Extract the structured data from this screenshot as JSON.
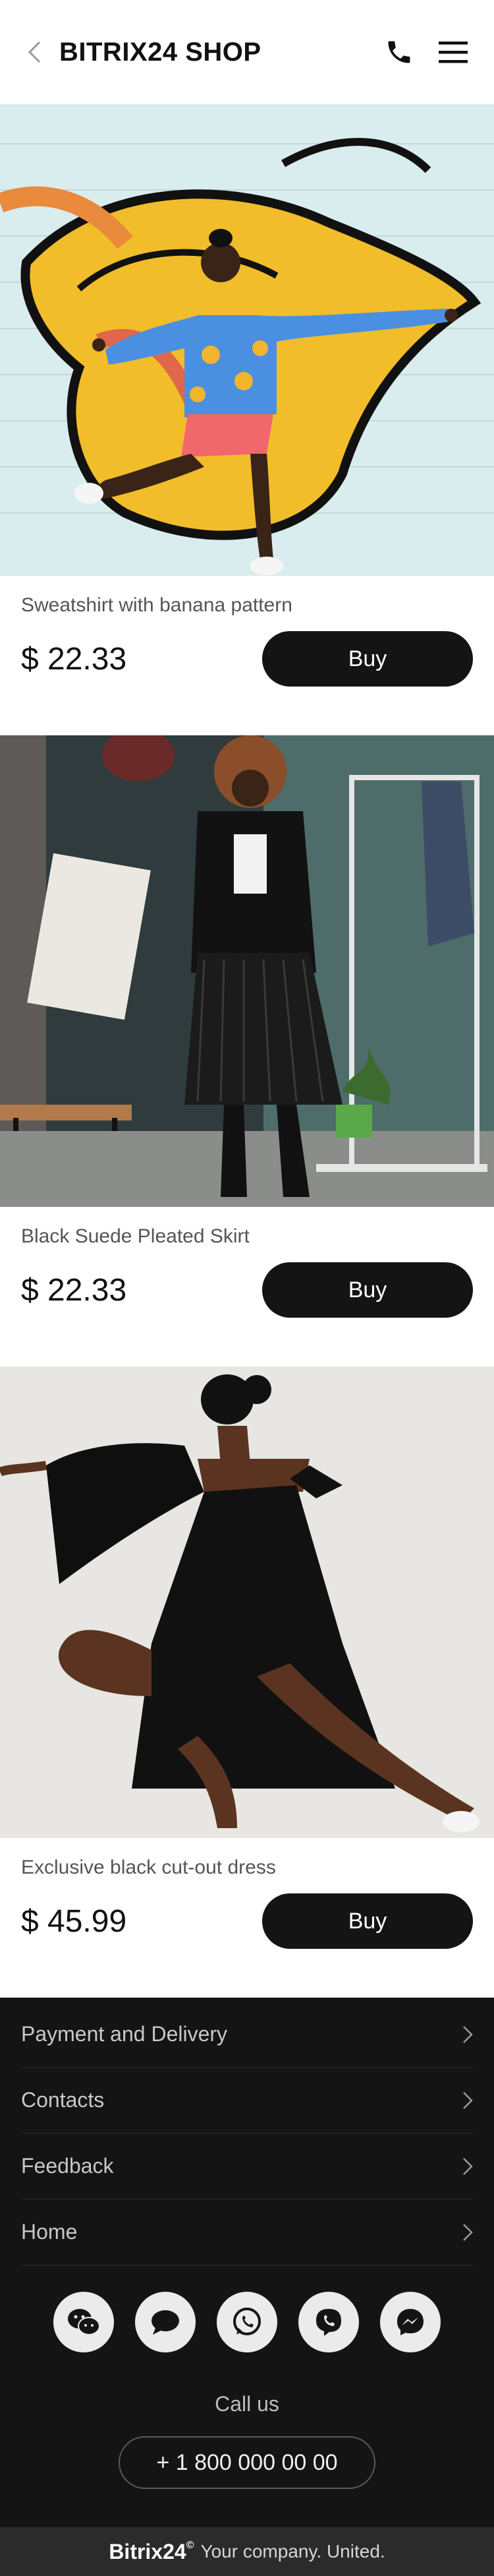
{
  "header": {
    "title": "BITRIX24 SHOP",
    "icons": [
      "chevron-left-icon",
      "phone-icon",
      "menu-icon"
    ]
  },
  "products": [
    {
      "name": "Sweatshirt with banana pattern",
      "price": "$ 22.33",
      "buy_label": "Buy"
    },
    {
      "name": "Black Suede Pleated Skirt",
      "price": "$ 22.33",
      "buy_label": "Buy"
    },
    {
      "name": "Exclusive black cut-out dress",
      "price": "$ 45.99",
      "buy_label": "Buy"
    }
  ],
  "footer": {
    "menu": [
      {
        "label": "Payment and Delivery"
      },
      {
        "label": "Contacts"
      },
      {
        "label": "Feedback"
      },
      {
        "label": "Home"
      }
    ],
    "socials": [
      "wechat-icon",
      "chat-icon",
      "whatsapp-icon",
      "viber-icon",
      "messenger-icon"
    ],
    "call_label": "Call us",
    "phone": "+ 1 800 000 00 00",
    "brand": "Bitrix24",
    "brand_mark": "©",
    "company": "Your company. United."
  }
}
